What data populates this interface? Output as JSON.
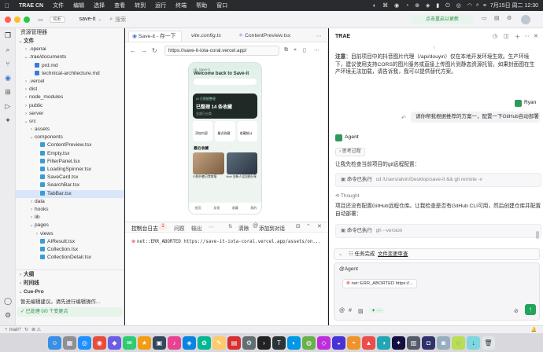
{
  "menubar": {
    "app_name": "TRAE CN",
    "items": [
      "文件",
      "编辑",
      "选择",
      "查看",
      "转到",
      "运行",
      "终端",
      "帮助",
      "窗口"
    ],
    "clock": "7月15日 周二  12:30"
  },
  "titlebar": {
    "ide_badge": "IDE",
    "project": "save-it",
    "search_placeholder": "搜索",
    "update_notice": "点击重启以更新"
  },
  "sidebar": {
    "title": "资源管理器",
    "files_header": "文件",
    "tree": [
      {
        "label": ".openai",
        "depth": 1,
        "type": "folder",
        "open": false
      },
      {
        "label": ".trae/documents",
        "depth": 1,
        "type": "folder",
        "open": true
      },
      {
        "label": "prd.md",
        "depth": 2,
        "type": "md"
      },
      {
        "label": "technical-architecture.md",
        "depth": 2,
        "type": "md"
      },
      {
        "label": ".vercel",
        "depth": 1,
        "type": "folder",
        "open": false
      },
      {
        "label": "dist",
        "depth": 1,
        "type": "folder",
        "open": false
      },
      {
        "label": "node_modules",
        "depth": 1,
        "type": "folder",
        "open": false
      },
      {
        "label": "public",
        "depth": 1,
        "type": "folder",
        "open": false
      },
      {
        "label": "server",
        "depth": 1,
        "type": "folder",
        "open": false
      },
      {
        "label": "src",
        "depth": 1,
        "type": "folder",
        "open": true
      },
      {
        "label": "assets",
        "depth": 2,
        "type": "folder",
        "open": false
      },
      {
        "label": "components",
        "depth": 2,
        "type": "folder",
        "open": true
      },
      {
        "label": "ContentPreview.tsx",
        "depth": 3,
        "type": "tsx"
      },
      {
        "label": "Empty.tsx",
        "depth": 3,
        "type": "tsx"
      },
      {
        "label": "FilterPanel.tsx",
        "depth": 3,
        "type": "tsx"
      },
      {
        "label": "LoadingSpinner.tsx",
        "depth": 3,
        "type": "tsx"
      },
      {
        "label": "SaveCard.tsx",
        "depth": 3,
        "type": "tsx"
      },
      {
        "label": "SearchBar.tsx",
        "depth": 3,
        "type": "tsx"
      },
      {
        "label": "TabBar.tsx",
        "depth": 3,
        "type": "tsx",
        "selected": true
      },
      {
        "label": "data",
        "depth": 2,
        "type": "folder",
        "open": false
      },
      {
        "label": "hooks",
        "depth": 2,
        "type": "folder",
        "open": false
      },
      {
        "label": "lib",
        "depth": 2,
        "type": "folder",
        "open": false
      },
      {
        "label": "pages",
        "depth": 2,
        "type": "folder",
        "open": true
      },
      {
        "label": "views",
        "depth": 3,
        "type": "folder",
        "open": false
      },
      {
        "label": "AIResult.tsx",
        "depth": 3,
        "type": "tsx"
      },
      {
        "label": "Collection.tsx",
        "depth": 3,
        "type": "tsx"
      },
      {
        "label": "CollectionDetail.tsx",
        "depth": 3,
        "type": "tsx"
      }
    ],
    "outline_header": "大纲",
    "timeline_header": "时间线",
    "cue_header": "Cue-Pro",
    "cue_text": "暂无编辑建议。请先进行编辑操作...",
    "cue_status": "已处理 0/0 个变更点"
  },
  "editor": {
    "tabs": [
      "Save-it - 存一下",
      "vite.config.ts",
      "ContentPreview.tsx"
    ],
    "url": "https://save-it-iota-coral.vercel.app/",
    "phone": {
      "greeting_small": "Hi, Save-it",
      "greeting": "Welcome back to Save-it",
      "card_small": "AI 已智能整理",
      "card_big": "已整理 14 条收藏",
      "card_sub": "全部已分类",
      "quick": [
        "添加内容",
        "最近收藏",
        "收藏统计"
      ],
      "section": "最近收藏",
      "posts": [
        "小狗外套日常穿搭",
        "Hurt 全新人设回顾分享"
      ],
      "nav": [
        "首页",
        "发现",
        "收藏",
        "我的"
      ]
    },
    "panel_tabs": {
      "console": "控制台日志",
      "count": "1",
      "problems": "问题",
      "output": "输出",
      "clear": "清除",
      "add_chat": "添加到对话"
    },
    "console_line": "net::ERR_ABORTED https://save-it-iota-coral.vercel.app/assets/on..."
  },
  "right": {
    "title": "TRAE",
    "note_bold": "注意",
    "note_text": "：目前项目中的抖音图片代理（/api/douyin）仅在本地开发环境生效。生产环境下，建议使用支持CORS的图片服务或直接上传图片到静态资源托管。如果封面图在生产环境无法加载，请告诉我，我可以提供替代方案。",
    "user_name": "Ryan",
    "user_message": "请你帮我根据推荐的方案一，配置一下GitHub自动部署",
    "agent_label": "Agent",
    "thought_toggle": "思考过程",
    "msg1": "让我先检查当前项目的git远程配置：",
    "cmd1_label": "命令已执行",
    "cmd1": "cd /Users/alvin/Desktop/save-it && git remote -v",
    "thought_label": "Thought",
    "msg2": "项目还没有配置GitHub远程仓库。让我检查是否有GitHub CLI可用，然后创建仓库并配置自动部署：",
    "cmd2_label": "命令已执行",
    "cmd2": "gh --version",
    "task_done": "任务完成",
    "file_changes": "文件变更审查",
    "input_agent": "@Agent",
    "error_chip": "net::ERR_ABORTED https://..."
  },
  "statusbar": {
    "branch": "main*"
  }
}
